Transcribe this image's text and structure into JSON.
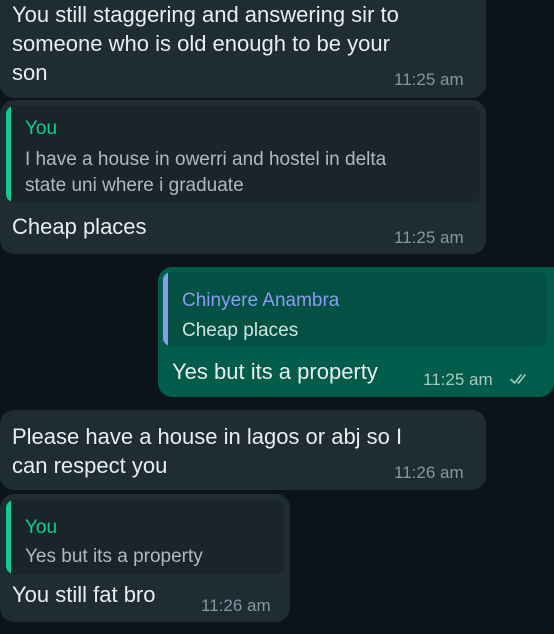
{
  "colors": {
    "background": "#0b141a",
    "incoming_bubble": "#1f2c33",
    "outgoing_bubble": "#005c4b",
    "quote_you": "#06cf9c",
    "quote_other": "#8b9cf0",
    "read_ticks": "#a7c9c1"
  },
  "messages": [
    {
      "direction": "incoming",
      "text": "You still staggering and answering sir to\nsomeone who is old enough to be your\nson",
      "time": "11:25 am"
    },
    {
      "direction": "incoming",
      "quote": {
        "author": "You",
        "text": "I have a house in owerri and hostel in delta\nstate uni where i graduate"
      },
      "text": "Cheap places",
      "time": "11:25 am"
    },
    {
      "direction": "outgoing",
      "quote": {
        "author": "Chinyere Anambra",
        "text": "Cheap places"
      },
      "text": "Yes but its a property",
      "time": "11:25 am",
      "status_icon": "double-check-icon"
    },
    {
      "direction": "incoming",
      "text": "Please have a house in lagos or abj so I\ncan respect you",
      "time": "11:26 am"
    },
    {
      "direction": "incoming",
      "quote": {
        "author": "You",
        "text": "Yes but its a property"
      },
      "text": "You still fat bro",
      "time": "11:26 am"
    }
  ]
}
